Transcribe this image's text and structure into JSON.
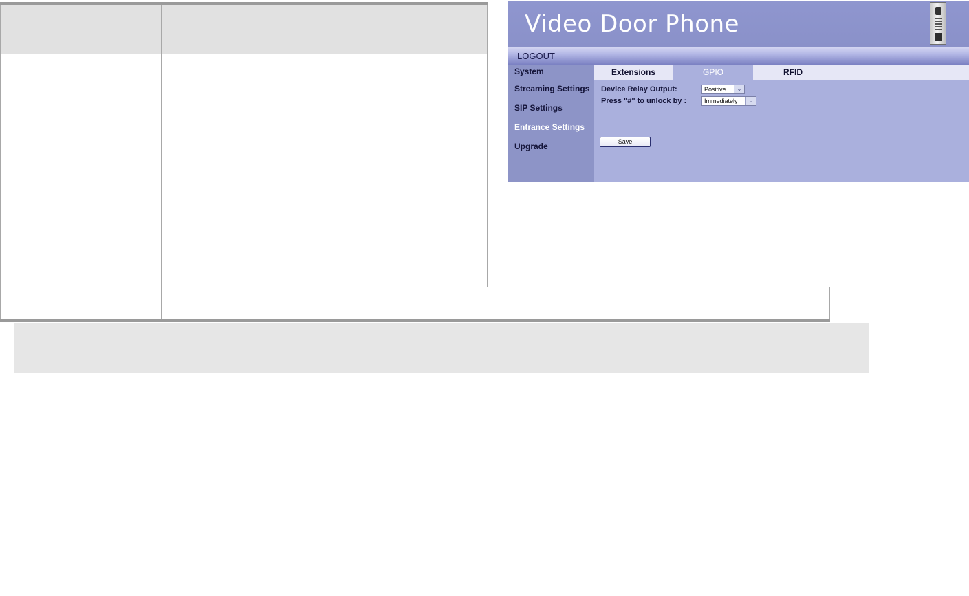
{
  "app": {
    "title": "Video Door Phone",
    "logout_label": "LOGOUT"
  },
  "sidebar": {
    "items": [
      {
        "label": "System",
        "active": false
      },
      {
        "label": "Streaming Settings",
        "active": false
      },
      {
        "label": "SIP Settings",
        "active": false
      },
      {
        "label": "Entrance Settings",
        "active": true
      },
      {
        "label": "Upgrade",
        "active": false
      }
    ]
  },
  "tabs": [
    {
      "label": "Extensions",
      "active": false
    },
    {
      "label": "GPIO",
      "active": true
    },
    {
      "label": "RFID",
      "active": false
    }
  ],
  "form": {
    "relay_label": "Device Relay Output:",
    "relay_value": "Positive",
    "unlock_label": "Press \"#\" to unlock by :",
    "unlock_value": "Immediately",
    "save_label": "Save"
  },
  "icons": {
    "dropdown": "chevron-down-icon",
    "device": "door-phone-device-icon"
  }
}
